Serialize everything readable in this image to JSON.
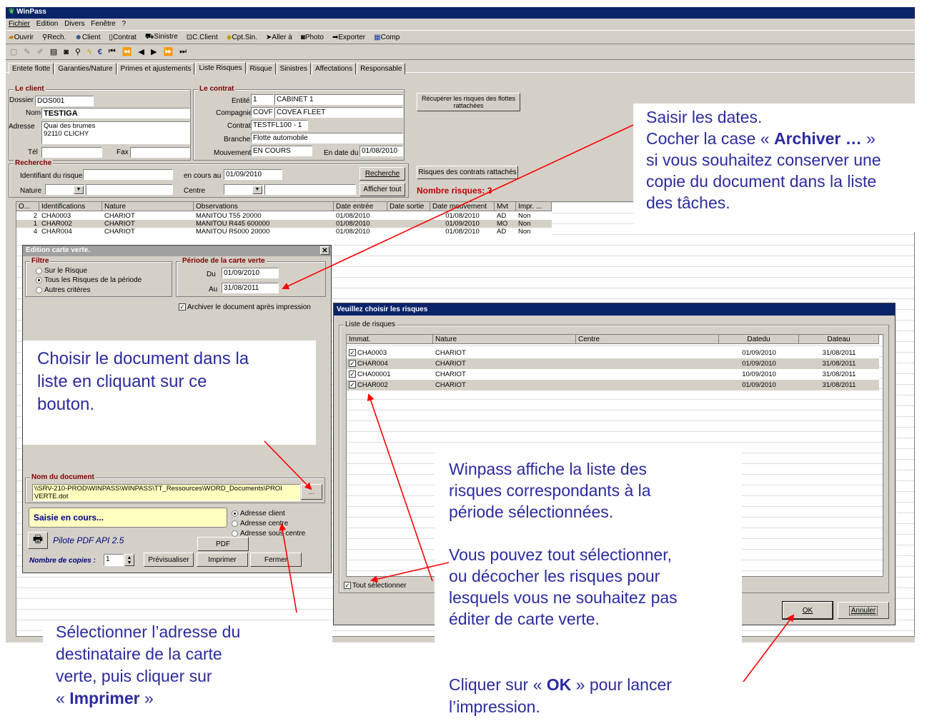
{
  "app": {
    "title": "WinPass",
    "menu": [
      "Fichier",
      "Edition",
      "Divers",
      "Fenêtre",
      "?"
    ],
    "toolbar": [
      "Ouvrir",
      "Rech.",
      "Client",
      "Contrat",
      "Sinistre",
      "C.Client",
      "Cpt.Sin.",
      "Aller à",
      "Photo",
      "Exporter",
      "Comp"
    ],
    "tabs": [
      "Entete flotte",
      "Garanties/Nature",
      "Primes et ajustements",
      "Liste Risques",
      "Risque",
      "Sinistres",
      "Affectations",
      "Responsable"
    ]
  },
  "client": {
    "title": "Le client",
    "dossier_label": "Dossier",
    "dossier": "DOS001",
    "nom_label": "Nom",
    "nom": "TESTIGA",
    "adresse_label": "Adresse",
    "adresse1": "Quai des brumes",
    "adresse2": "92110 CLICHY",
    "tel_label": "Tél",
    "fax_label": "Fax"
  },
  "contrat": {
    "title": "Le contrat",
    "entite_label": "Entité",
    "entite_code": "1",
    "entite_name": "CABINET 1",
    "compagnie_label": "Compagnie",
    "compagnie_code": "COVF",
    "compagnie_name": "COVEA FLEET",
    "contrat_label": "Contrat",
    "contrat": "TESTFL100 - 1",
    "branche_label": "Branche",
    "branche": "Flotte automobile",
    "mouvement_label": "Mouvement",
    "mouvement": "EN COURS",
    "endate_label": "En date du",
    "endate": "01/08/2010"
  },
  "recup_button": "Récupérer les risques des flottes rattachées",
  "recherche": {
    "title": "Recherche",
    "ident_label": "Identifiant du risque",
    "encours_label": "en cours au",
    "encours": "01/09/2010",
    "nature_label": "Nature",
    "centre_label": "Centre",
    "recherche_btn": "Recherche",
    "affichertout_btn": "Afficher tout",
    "risques_contrats_btn": "Risques des contrats rattachés",
    "nombre_risques": "Nombre risques: 3"
  },
  "risks_table": {
    "headers": [
      "O...",
      "Identifications",
      "Nature",
      "Observations",
      "Date entrée",
      "Date sortie",
      "Date mouvement",
      "Mvt",
      "Impr. ..."
    ],
    "rows": [
      [
        "2",
        "CHA0003",
        "CHARIOT",
        "MANITOU T55  20000",
        "01/08/2010",
        "",
        "01/08/2010",
        "AD",
        "Non"
      ],
      [
        "1",
        "CHAR002",
        "CHARIOT",
        "MANITOU R445  600000",
        "01/08/2010",
        "",
        "01/09/2010",
        "MO",
        "Non"
      ],
      [
        "4",
        "CHAR004",
        "CHARIOT",
        "MANITOU R5000  20000",
        "01/08/2010",
        "",
        "01/08/2010",
        "AD",
        "Non"
      ]
    ]
  },
  "dialog_edition": {
    "title": "Edition carte verte.",
    "filtre_title": "Filtre",
    "filtre_options": [
      "Sur le Risque",
      "Tous les Risques de la période",
      "Autres critères"
    ],
    "periode_title": "Période de la carte verte",
    "du_label": "Du",
    "du": "01/09/2010",
    "au_label": "Au",
    "au": "31/08/2011",
    "archiver_label": "Archiver le document après impression",
    "nomdoc_title": "Nom du document",
    "nomdoc": "\\\\SRV-210-PROD\\WINPASS\\WINPASS\\TT_Ressources\\WORD_Documents\\PROI",
    "nomdoc2": "VERTE.dot",
    "saisie": "Saisie en cours...",
    "adresse_options": [
      "Adresse client",
      "Adresse centre",
      "Adresse sous centre"
    ],
    "pilote": "Pilote PDF API 2.5",
    "pdf_btn": "PDF",
    "copies_label": "Nombre de copies :",
    "copies": "1",
    "previsualiser_btn": "Prévisualiser",
    "imprimer_btn": "Imprimer",
    "fermer_btn": "Fermer"
  },
  "dialog_risques": {
    "title": "Veuillez choisir les risques",
    "group_title": "Liste de risques",
    "headers": [
      "Immat.",
      "Nature",
      "Centre",
      "Datedu",
      "Dateau"
    ],
    "rows": [
      [
        "CHA0003",
        "CHARIOT",
        "",
        "01/09/2010",
        "31/08/2011"
      ],
      [
        "CHAR004",
        "CHARIOT",
        "",
        "01/09/2010",
        "31/08/2011"
      ],
      [
        "CHA00001",
        "CHARIOT",
        "",
        "10/09/2010",
        "31/08/2011"
      ],
      [
        "CHAR002",
        "CHARIOT",
        "",
        "01/09/2010",
        "31/08/2011"
      ]
    ],
    "tout_label": "Tout sélectionner",
    "ok_btn": "OK",
    "annuler_btn": "Annuler"
  },
  "annotations": {
    "a1_l1": "Saisir les dates.",
    "a1_l2_pre": "Cocher la case « ",
    "a1_l2_bold": "Archiver …",
    "a1_l2_post": " »",
    "a1_l3": "si vous souhaitez conserver une",
    "a1_l4": "copie du document dans la liste",
    "a1_l5": "des tâches.",
    "a2_l1": "Choisir le document dans la",
    "a2_l2": "liste en cliquant sur ce",
    "a2_l3": "bouton.",
    "a3_l1": "Winpass affiche la liste des",
    "a3_l2": "risques correspondants à la",
    "a3_l3": "période sélectionnées.",
    "a4_l1": "Vous pouvez tout sélectionner,",
    "a4_l2": "ou décocher les risques pour",
    "a4_l3": "lesquels vous ne souhaitez pas",
    "a4_l4": "éditer de carte verte.",
    "a5_l1": "Sélectionner l’adresse du",
    "a5_l2": "destinataire de la carte",
    "a5_l3": "verte, puis cliquer sur",
    "a5_l4_pre": "« ",
    "a5_l4_bold": "Imprimer",
    "a5_l4_post": " »",
    "a6_pre": "Cliquer sur « ",
    "a6_bold": "OK",
    "a6_post": " » pour lancer",
    "a6_l2": "l’impression."
  }
}
